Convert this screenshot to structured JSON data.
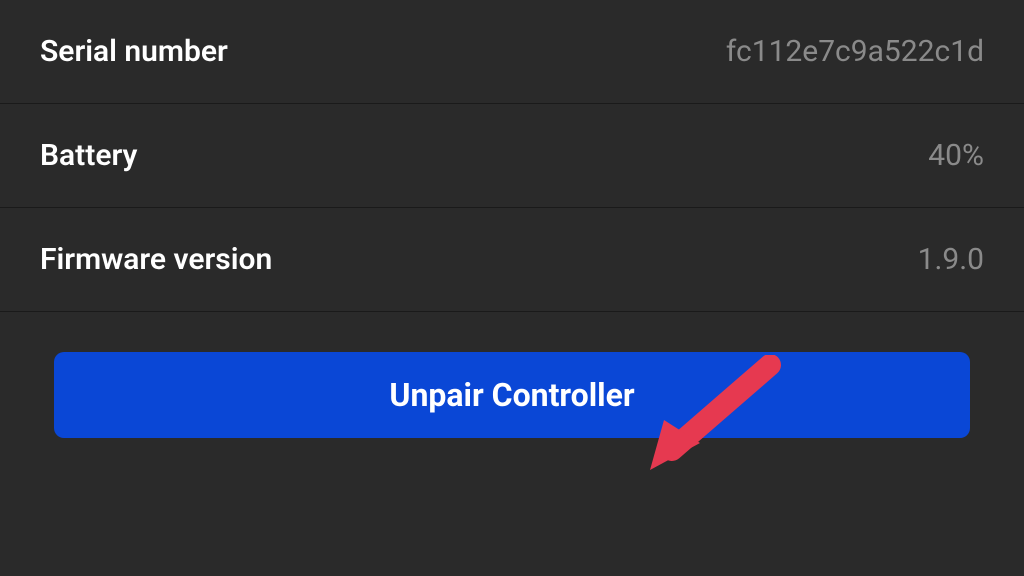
{
  "settings": {
    "serial": {
      "label": "Serial number",
      "value": "fc112e7c9a522c1d"
    },
    "battery": {
      "label": "Battery",
      "value": "40%"
    },
    "firmware": {
      "label": "Firmware version",
      "value": "1.9.0"
    }
  },
  "actions": {
    "unpair_label": "Unpair Controller"
  },
  "colors": {
    "background": "#2a2a2a",
    "button": "#0a47d6",
    "text_primary": "#ffffff",
    "text_secondary": "#8a8a8a",
    "arrow": "#e63950"
  }
}
